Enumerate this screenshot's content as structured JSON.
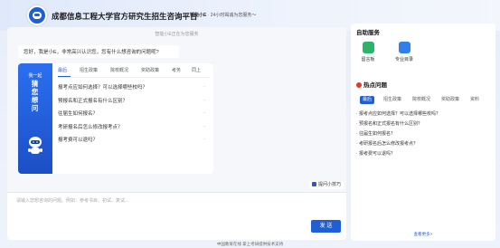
{
  "header": {
    "title": "成都信息工程大学官方研究生招生咨询平台",
    "tag_bold": "智能小E",
    "tag_text": "· 24小时竭诚为您服务～"
  },
  "chat": {
    "status": "智能小E正在为您服务",
    "greeting": "您好，我是小E，非常高兴认识您，您有什么想咨询的问题呢?",
    "banner": {
      "small": "我一起",
      "big_lines": [
        "猜",
        "您",
        "想",
        "问"
      ]
    },
    "tabs": [
      "最后",
      "招生政策",
      "院校概况",
      "奖助政策",
      "考务",
      "同上"
    ],
    "faq": [
      "报考点应如何选择？可以选择哪些校吗？",
      "预报名和正式报名有什么区别？",
      "往届生如何报名？",
      "考研报名后怎么修改报考点？",
      "报考费可以退吗？"
    ],
    "tips_label": "提问小技巧",
    "input_placeholder": "请输入您想咨询的问题。例如：参考书目、初试、复试...",
    "send_label": "发 送"
  },
  "right": {
    "self_service_title": "自助服务",
    "services": [
      {
        "label": "留言板",
        "icon": "message-board-icon",
        "color": "#2db36a"
      },
      {
        "label": "专业目录",
        "icon": "catalog-book-icon",
        "color": "#2f80ed"
      }
    ],
    "hot_title": "热点问题",
    "hot_tabs": [
      "最后",
      "招生政策",
      "院校概况",
      "奖助政策",
      "资料"
    ],
    "hot_items": [
      "· 报考点应如何选择？可以选择哪些校吗？",
      "· 预报名和正式报名有什么区别？",
      "· 往届生如何报名？",
      "· 考研报名后怎么修改报考点？",
      "· 报考费可以退吗？"
    ],
    "more_label": "查看更多>"
  },
  "footer": "中国教育在线 掌上考研提供技术支持",
  "colors": {
    "accent": "#1f5fd6",
    "hot": "#e8372c"
  }
}
